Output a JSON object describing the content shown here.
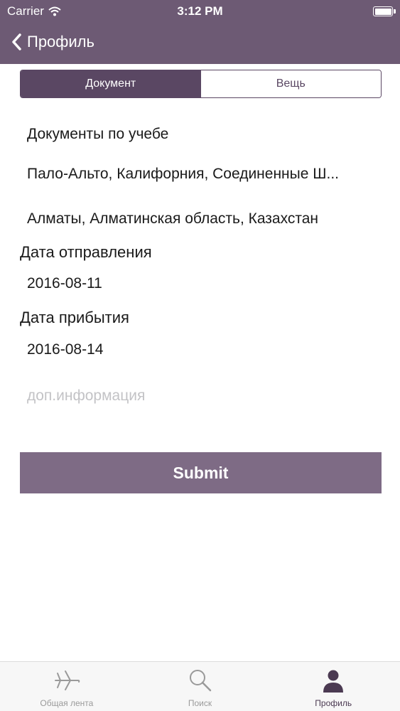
{
  "status_bar": {
    "carrier": "Carrier",
    "time": "3:12 PM"
  },
  "nav": {
    "back_title": "Профиль"
  },
  "segments": [
    {
      "label": "Документ",
      "active": true
    },
    {
      "label": "Вещь",
      "active": false
    }
  ],
  "form": {
    "item_name": "Документы по учебе",
    "from_location": "Пало-Альто, Калифорния, Соединенные Ш...",
    "to_location": "Алматы, Алматинская область, Казахстан",
    "departure_label": "Дата отправления",
    "departure_date": "2016-08-11",
    "arrival_label": "Дата прибытия",
    "arrival_date": "2016-08-14",
    "extra_placeholder": "доп.информация"
  },
  "submit_label": "Submit",
  "tabbar": {
    "items": [
      {
        "label": "Общая лента",
        "icon": "airplane-icon",
        "active": false
      },
      {
        "label": "Поиск",
        "icon": "search-icon",
        "active": false
      },
      {
        "label": "Профиль",
        "icon": "profile-icon",
        "active": true
      }
    ]
  },
  "colors": {
    "accent": "#6d5a74",
    "segment_active": "#5a4763",
    "button": "#7e6b85"
  }
}
